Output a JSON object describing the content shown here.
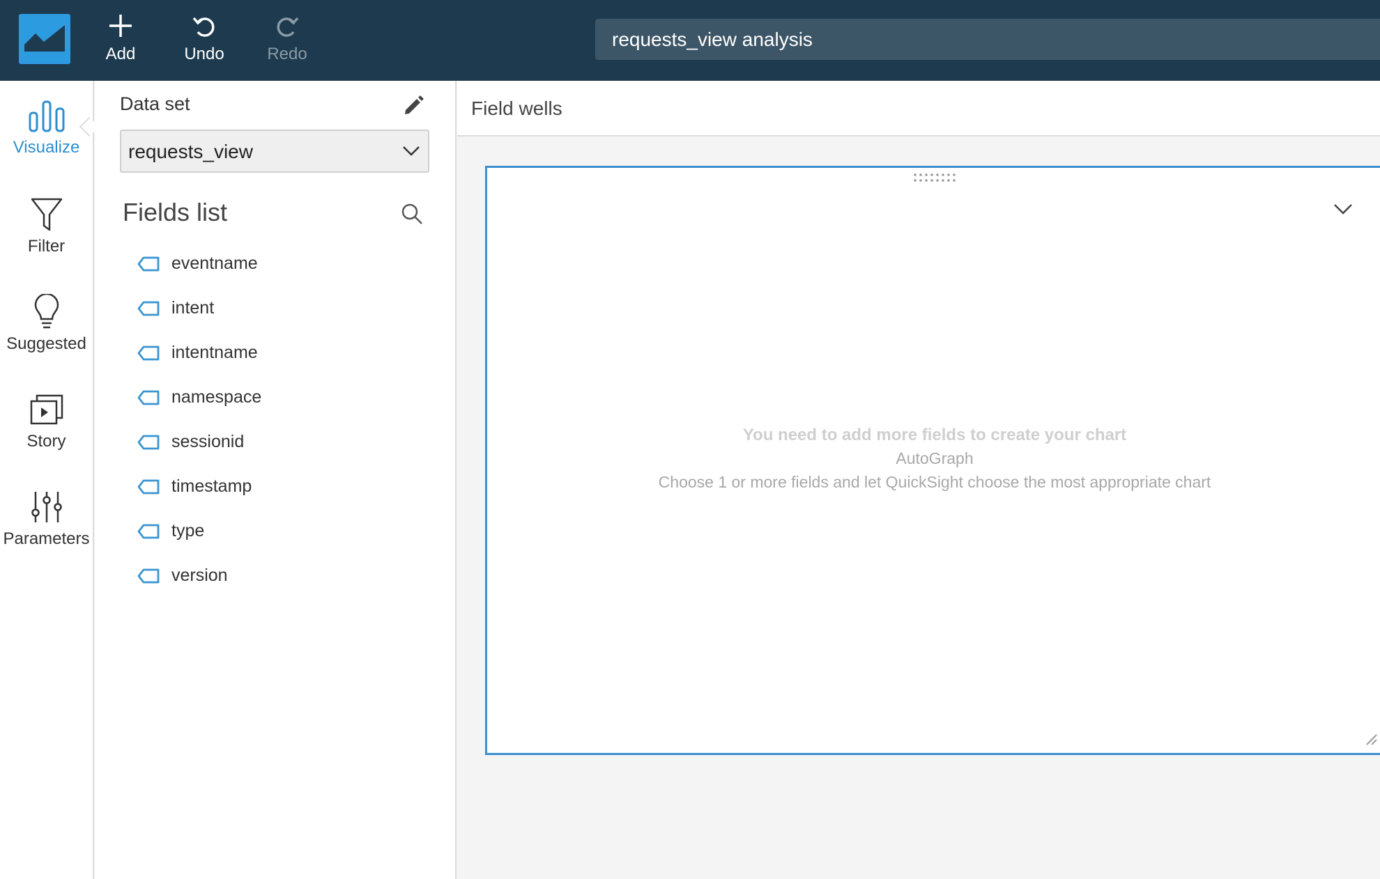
{
  "toolbar": {
    "add_label": "Add",
    "undo_label": "Undo",
    "redo_label": "Redo"
  },
  "analysis_title": "requests_view analysis",
  "nav": {
    "items": [
      {
        "label": "Visualize",
        "icon": "bar-chart-icon",
        "active": true
      },
      {
        "label": "Filter",
        "icon": "filter-icon",
        "active": false
      },
      {
        "label": "Suggested",
        "icon": "lightbulb-icon",
        "active": false
      },
      {
        "label": "Story",
        "icon": "story-icon",
        "active": false
      },
      {
        "label": "Parameters",
        "icon": "sliders-icon",
        "active": false
      }
    ]
  },
  "dataset": {
    "label": "Data set",
    "selected": "requests_view"
  },
  "fields": {
    "title": "Fields list",
    "items": [
      "eventname",
      "intent",
      "intentname",
      "namespace",
      "sessionid",
      "timestamp",
      "type",
      "version"
    ]
  },
  "field_wells": {
    "label": "Field wells"
  },
  "visual": {
    "empty_title": "You need to add more fields to create your chart",
    "empty_subtitle": "AutoGraph",
    "empty_description": "Choose 1 or more fields and let QuickSight choose the most appropriate chart"
  },
  "colors": {
    "topbar": "#1d3a4e",
    "accent": "#2d9be0",
    "visual_border": "#3c8fce"
  }
}
